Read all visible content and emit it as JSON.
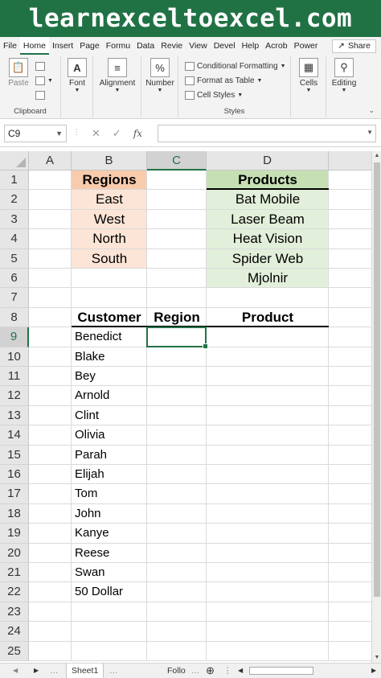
{
  "banner": {
    "text": "learnexceltoexcel.com"
  },
  "ribbon_tabs": [
    "File",
    "Home",
    "Insert",
    "Page",
    "Formu",
    "Data",
    "Revie",
    "View",
    "Devel",
    "Help",
    "Acrob",
    "Power"
  ],
  "share_label": "Share",
  "ribbon": {
    "paste": "Paste",
    "clipboard": "Clipboard",
    "font": "Font",
    "alignment": "Alignment",
    "number": "Number",
    "number_icon": "%",
    "conditional_formatting": "Conditional Formatting",
    "format_as_table": "Format as Table",
    "cell_styles": "Cell Styles",
    "styles": "Styles",
    "cells": "Cells",
    "editing": "Editing"
  },
  "formula_bar": {
    "name_box": "C9",
    "fx": "fx",
    "value": ""
  },
  "columns": [
    "A",
    "B",
    "C",
    "D"
  ],
  "rows": [
    "1",
    "2",
    "3",
    "4",
    "5",
    "6",
    "7",
    "8",
    "9",
    "10",
    "11",
    "12",
    "13",
    "14",
    "15",
    "16",
    "17",
    "18",
    "19",
    "20",
    "21",
    "22",
    "23",
    "24",
    "25"
  ],
  "selected_cell": "C9",
  "regions": {
    "header": "Regions",
    "items": [
      "East",
      "West",
      "North",
      "South"
    ]
  },
  "products": {
    "header": "Products",
    "items": [
      "Bat Mobile",
      "Laser Beam",
      "Heat Vision",
      "Spider Web",
      "Mjolnir"
    ]
  },
  "table_headers": {
    "customer": "Customer",
    "region": "Region",
    "product": "Product"
  },
  "customers": [
    "Benedict",
    "Blake",
    "Bey",
    "Arnold",
    "Clint",
    "Olivia",
    "Parah",
    "Elijah",
    "Tom",
    "John",
    "Kanye",
    "Reese",
    "Swan",
    "50 Dollar"
  ],
  "sheet_tabs": [
    "Sheet1",
    "Follo"
  ],
  "colors": {
    "excel_green": "#217346",
    "regions_header": "#f8cbad",
    "regions_fill": "#fce4d6",
    "products_header": "#c6e0b4",
    "products_fill": "#e2efda"
  }
}
